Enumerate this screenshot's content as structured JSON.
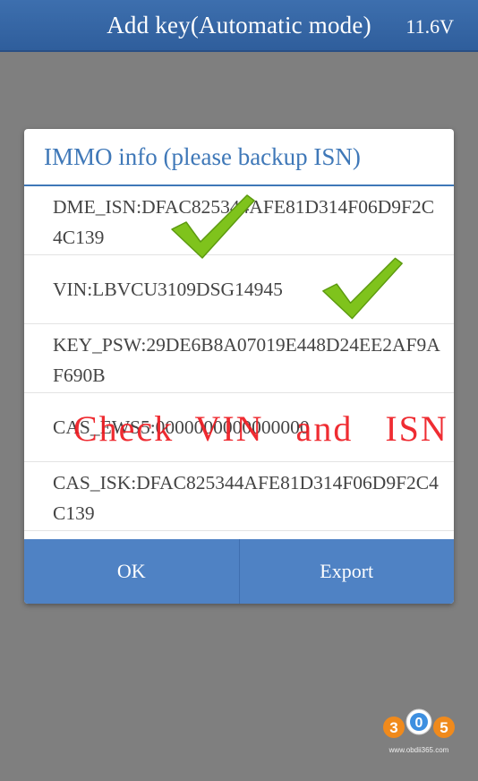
{
  "header": {
    "title": "Add key(Automatic mode)",
    "voltage": "11.6V"
  },
  "dialog": {
    "title": "IMMO info (please backup ISN)",
    "rows": [
      "DME_ISN:DFAC825344AFE81D314F06D9F2C4C139",
      "VIN:LBVCU3109DSG14945",
      "KEY_PSW:29DE6B8A07019E448D24EE2AF9AF690B",
      "CAS_EWS5:0000000000000000",
      "CAS_ISK:DFAC825344AFE81D314F06D9F2C4C139"
    ],
    "ok_label": "OK",
    "export_label": "Export"
  },
  "annotation": {
    "text": "Check  VIN   and   ISN",
    "color": "#ee1d23",
    "check_color": "#7fc31c"
  },
  "watermark": {
    "logo_text": "305",
    "url": "www.obdii365.com"
  }
}
